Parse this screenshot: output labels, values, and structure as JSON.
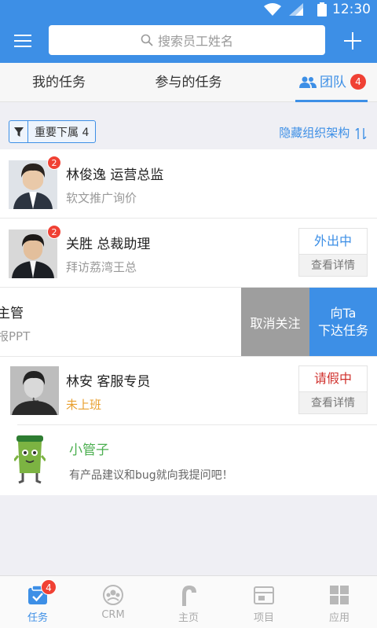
{
  "status_bar": {
    "time": "12:30"
  },
  "search": {
    "placeholder": "搜索员工姓名"
  },
  "tabs": [
    {
      "label": "我的任务"
    },
    {
      "label": "参与的任务"
    },
    {
      "label": "团队",
      "badge": "4",
      "active": true
    }
  ],
  "filter": {
    "chip_label": "重要下属 4",
    "hide_org_label": "隐藏组织架构"
  },
  "rows": [
    {
      "name": "林俊逸  运营总监",
      "sub": "软文推广询价",
      "badge": "2"
    },
    {
      "name": "关胜  总裁助理",
      "sub": "拜访荔湾王总",
      "badge": "2",
      "status": "外出中",
      "status_color": "#3d8fe6",
      "detail": "查看详情"
    },
    {
      "name": "主管",
      "sub": "报PPT",
      "cancel_follow": "取消关注",
      "assign_line1": "向Ta",
      "assign_line2": "下达任务"
    },
    {
      "name": "林安  客服专员",
      "sub": "未上班",
      "status": "请假中",
      "status_color": "#d0312d",
      "detail": "查看详情"
    }
  ],
  "bot": {
    "name": "小管子",
    "sub": "有产品建议和bug就向我提问吧！"
  },
  "bottom_nav": [
    {
      "label": "任务",
      "badge": "4",
      "active": true
    },
    {
      "label": "CRM"
    },
    {
      "label": "主页"
    },
    {
      "label": "项目"
    },
    {
      "label": "应用"
    }
  ],
  "colors": {
    "primary": "#3d8fe6",
    "badge": "#f04134",
    "away": "#3d8fe6",
    "leave": "#d0312d",
    "offline": "#e8a030",
    "bot": "#4caf50"
  }
}
